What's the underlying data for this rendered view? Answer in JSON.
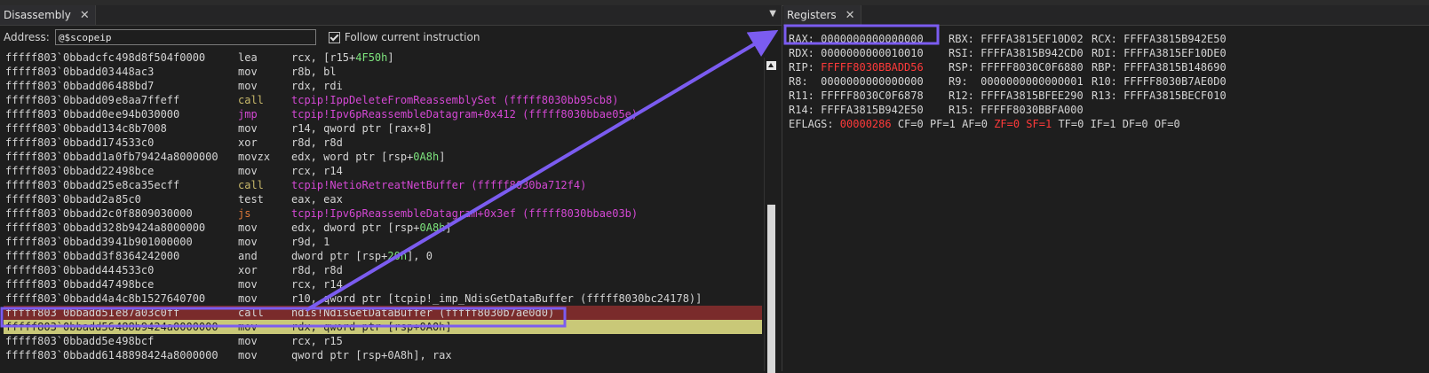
{
  "disassembly": {
    "tab_title": "Disassembly",
    "address_label": "Address:",
    "address_value": "@$scopeip",
    "follow_label": "Follow current instruction",
    "rows": [
      {
        "addr": "fffff803`0bbadcfc",
        "bytes": "498d8f504f0000",
        "mnemonic": "lea",
        "operand": "rcx, [r15+",
        "operand_hl": "4F50h",
        "operand_tail": "]"
      },
      {
        "addr": "fffff803`0bbadd03",
        "bytes": "448ac3",
        "mnemonic": "mov",
        "operand": "r8b, bl"
      },
      {
        "addr": "fffff803`0bbadd06",
        "bytes": "488bd7",
        "mnemonic": "mov",
        "operand": "rdx, rdi"
      },
      {
        "addr": "fffff803`0bbadd09",
        "bytes": "e8aa7ffeff",
        "mnemonic": "call",
        "operand": "tcpip!IppDeleteFromReassemblySet (fffff8030bb95cb8)"
      },
      {
        "addr": "fffff803`0bbadd0e",
        "bytes": "e94b030000",
        "mnemonic": "jmp",
        "operand": "tcpip!Ipv6pReassembleDatagram+0x412 (fffff8030bbae05e)"
      },
      {
        "addr": "fffff803`0bbadd13",
        "bytes": "4c8b7008",
        "mnemonic": "mov",
        "operand": "r14, qword ptr [rax+8]"
      },
      {
        "addr": "fffff803`0bbadd17",
        "bytes": "4533c0",
        "mnemonic": "xor",
        "operand": "r8d, r8d"
      },
      {
        "addr": "fffff803`0bbadd1a",
        "bytes": "0fb79424a8000000",
        "mnemonic": "movzx",
        "operand": "edx, word ptr [rsp+",
        "operand_hl": "0A8h",
        "operand_tail": "]"
      },
      {
        "addr": "fffff803`0bbadd22",
        "bytes": "498bce",
        "mnemonic": "mov",
        "operand": "rcx, r14"
      },
      {
        "addr": "fffff803`0bbadd25",
        "bytes": "e8ca35ecff",
        "mnemonic": "call",
        "operand": "tcpip!NetioRetreatNetBuffer (fffff8030ba712f4)"
      },
      {
        "addr": "fffff803`0bbadd2a",
        "bytes": "85c0",
        "mnemonic": "test",
        "operand": "eax, eax"
      },
      {
        "addr": "fffff803`0bbadd2c",
        "bytes": "0f8809030000",
        "mnemonic": "js",
        "operand": "tcpip!Ipv6pReassembleDatagram+0x3ef (fffff8030bbae03b)"
      },
      {
        "addr": "fffff803`0bbadd32",
        "bytes": "8b9424a8000000",
        "mnemonic": "mov",
        "operand": "edx, dword ptr [rsp+",
        "operand_hl": "0A8h",
        "operand_tail": "]"
      },
      {
        "addr": "fffff803`0bbadd39",
        "bytes": "41b901000000",
        "mnemonic": "mov",
        "operand": "r9d, 1"
      },
      {
        "addr": "fffff803`0bbadd3f",
        "bytes": "8364242000",
        "mnemonic": "and",
        "operand": "dword ptr [rsp+",
        "operand_hl": "20h",
        "operand_tail": "], 0"
      },
      {
        "addr": "fffff803`0bbadd44",
        "bytes": "4533c0",
        "mnemonic": "xor",
        "operand": "r8d, r8d"
      },
      {
        "addr": "fffff803`0bbadd47",
        "bytes": "498bce",
        "mnemonic": "mov",
        "operand": "rcx, r14"
      },
      {
        "addr": "fffff803`0bbadd4a",
        "bytes": "4c8b1527640700",
        "mnemonic": "mov",
        "operand": "r10, qword ptr [tcpip!_imp_NdisGetDataBuffer (fffff8030bc24178)]"
      },
      {
        "addr": "fffff803`0bbadd51",
        "bytes": "e87a03c0ff",
        "mnemonic": "call",
        "operand": "ndis!NdisGetDataBuffer (fffff8030b7ae0d0)"
      },
      {
        "addr": "fffff803`0bbadd56",
        "bytes": "488b9424a0000000",
        "mnemonic": "mov",
        "operand": "rdx, qword ptr [rsp+0A0h]"
      },
      {
        "addr": "fffff803`0bbadd5e",
        "bytes": "498bcf",
        "mnemonic": "mov",
        "operand": "rcx, r15"
      },
      {
        "addr": "fffff803`0bbadd61",
        "bytes": "48898424a8000000",
        "mnemonic": "mov",
        "operand": "qword ptr [rsp+0A8h], rax"
      }
    ],
    "breakpoint_row": 18,
    "current_row": 19
  },
  "registers": {
    "tab_title": "Registers",
    "rows": [
      [
        "RAX: 0000000000000000",
        "RBX: FFFFA3815EF10D02",
        "RCX: FFFFA3815B942E50"
      ],
      [
        "RDX: 0000000000010010",
        "RSI: FFFFA3815B942CD0",
        "RDI: FFFFA3815EF10DE0"
      ],
      [
        "RIP: FFFFF8030BBADD56",
        "RSP: FFFFF8030C0F6880",
        "RBP: FFFFA3815B148690"
      ],
      [
        "R8:  0000000000000000",
        "R9:  0000000000000001",
        "R10: FFFFF8030B7AE0D0"
      ],
      [
        "R11: FFFFF8030C0F6878",
        "R12: FFFFA3815BFEE290",
        "R13: FFFFA3815BECF010"
      ],
      [
        "R14: FFFFA3815B942E50",
        "R15: FFFFF8030BBFA000"
      ]
    ],
    "rip_label": "RIP: ",
    "rip_value": "FFFFF8030BBADD56",
    "eflags_label": "EFLAGS: ",
    "eflags_value": "00000286",
    "flags_pre": " CF=0 PF=1 AF=0 ",
    "flags_changed": "ZF=0 SF=1",
    "flags_post": " TF=0 IF=1 DF=0 OF=0"
  },
  "colors": {
    "breakpoint_bg": "#7a2b2b",
    "current_bg": "#c9c878",
    "annotation": "#7b5cf0",
    "call_mnemonic": "#c8b86a",
    "jump_mnemonic": "#d448d4",
    "symbol": "#d448d4",
    "immediate": "#7de37d",
    "changed_register": "#ff3a3a"
  }
}
